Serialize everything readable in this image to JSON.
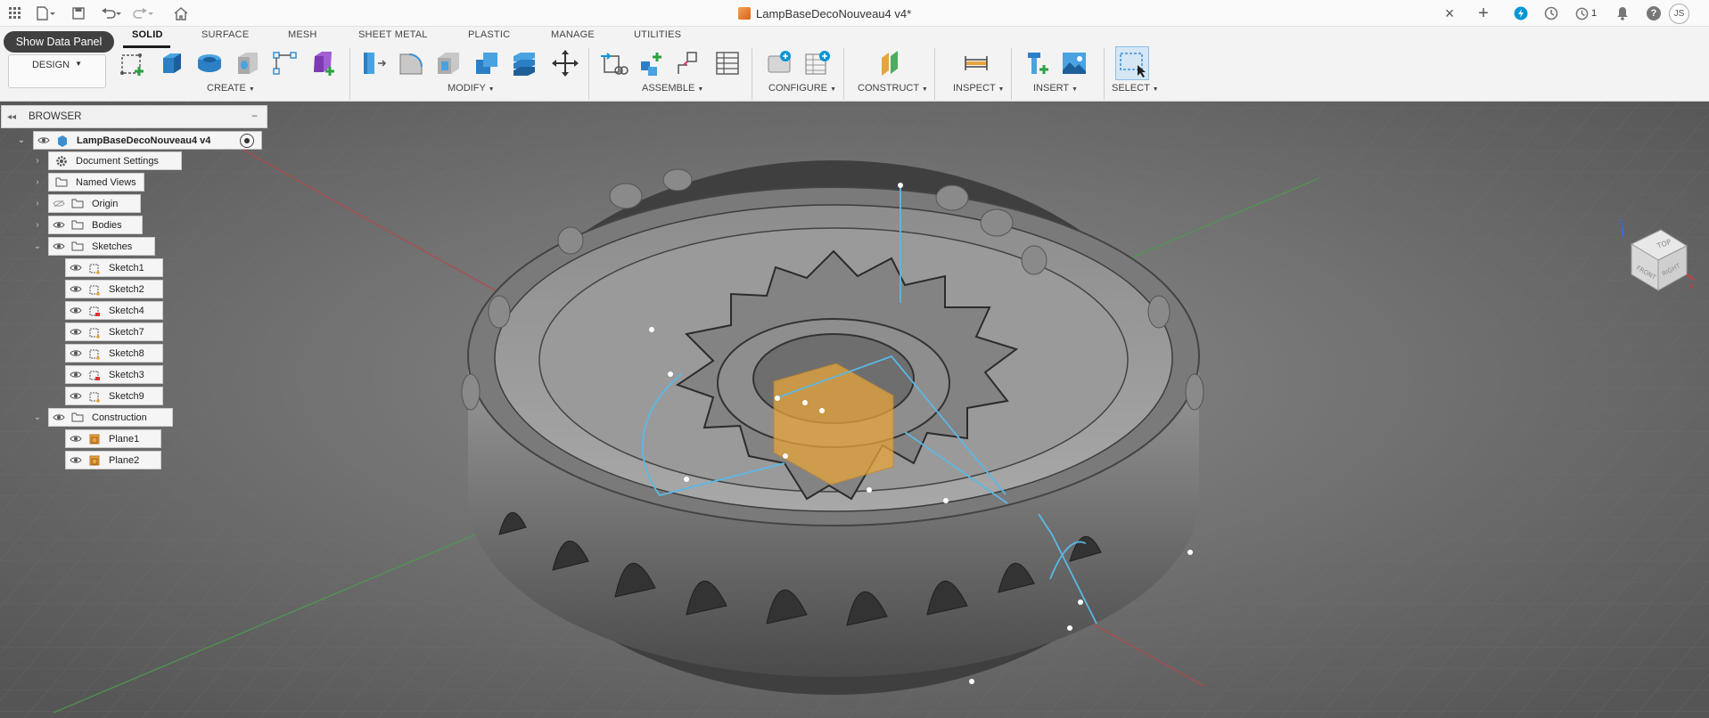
{
  "title_bar": {
    "document_title": "LampBaseDecoNouveau4 v4*",
    "notification_count": "1",
    "user_initials": "JS",
    "close_glyph": "×",
    "new_tab_glyph": "+",
    "help_glyph": "?"
  },
  "ribbon": {
    "show_data_panel_label": "Show Data Panel",
    "workspace_label": "DESIGN",
    "tabs": [
      {
        "label": "SOLID"
      },
      {
        "label": "SURFACE"
      },
      {
        "label": "MESH"
      },
      {
        "label": "SHEET METAL"
      },
      {
        "label": "PLASTIC"
      },
      {
        "label": "MANAGE"
      },
      {
        "label": "UTILITIES"
      }
    ],
    "groups": [
      {
        "label": "CREATE"
      },
      {
        "label": "MODIFY"
      },
      {
        "label": "ASSEMBLE"
      },
      {
        "label": "CONFIGURE"
      },
      {
        "label": "CONSTRUCT"
      },
      {
        "label": "INSPECT"
      },
      {
        "label": "INSERT"
      },
      {
        "label": "SELECT"
      }
    ]
  },
  "browser": {
    "header": "BROWSER",
    "root": "LampBaseDecoNouveau4 v4",
    "nodes": [
      {
        "label": "Document Settings"
      },
      {
        "label": "Named Views"
      },
      {
        "label": "Origin"
      },
      {
        "label": "Bodies"
      },
      {
        "label": "Sketches"
      },
      {
        "label": "Sketch1"
      },
      {
        "label": "Sketch2"
      },
      {
        "label": "Sketch4"
      },
      {
        "label": "Sketch7"
      },
      {
        "label": "Sketch8"
      },
      {
        "label": "Sketch3"
      },
      {
        "label": "Sketch9"
      },
      {
        "label": "Construction"
      },
      {
        "label": "Plane1"
      },
      {
        "label": "Plane2"
      }
    ]
  },
  "viewcube": {
    "top_label": "TOP",
    "front_label": "FRONT",
    "right_label": "RIGHT",
    "axis_z": "Z",
    "axis_x": "X"
  },
  "colors": {
    "accent": "#0696d7",
    "sketch_line": "#5bb8e6",
    "plane_fill": "#e6a53a",
    "viewport_bg": "#5c5c5c"
  }
}
